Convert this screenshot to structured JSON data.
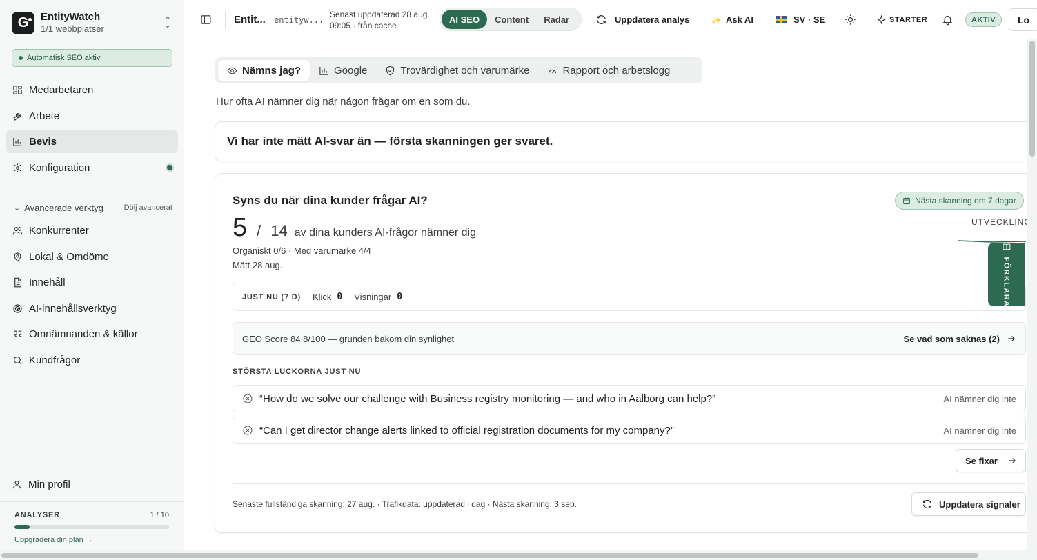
{
  "brand": {
    "name": "EntityWatch",
    "logo_letter": "G",
    "sites": "1/1 webbplatser"
  },
  "sidebar": {
    "seo_badge": "Automatisk SEO aktiv",
    "items": [
      {
        "label": "Medarbetaren",
        "icon": "dashboard-icon"
      },
      {
        "label": "Arbete",
        "icon": "wrench-icon"
      },
      {
        "label": "Bevis",
        "icon": "bar-chart-icon",
        "active": true
      },
      {
        "label": "Konfiguration",
        "icon": "gear-icon"
      }
    ],
    "advanced": {
      "label": "Avancerade verktyg",
      "hide": "Dölj avancerat"
    },
    "advanced_items": [
      {
        "label": "Konkurrenter",
        "icon": "users-icon"
      },
      {
        "label": "Lokal & Omdöme",
        "icon": "map-pin-icon"
      },
      {
        "label": "Innehåll",
        "icon": "document-icon"
      },
      {
        "label": "AI-innehållsverktyg",
        "icon": "target-icon"
      },
      {
        "label": "Omnämnanden & källor",
        "icon": "quote-icon"
      },
      {
        "label": "Kundfrågor",
        "icon": "search-icon"
      }
    ],
    "profile": "Min profil",
    "usage": {
      "label": "ANALYSER",
      "count": "1 / 10",
      "progress": 0.1,
      "upgrade": "Uppgradera din plan →"
    }
  },
  "topbar": {
    "site_name": "Entit...",
    "site_domain": "entityw...",
    "updated": "Senast uppdaterad 28 aug. 09:05 · från cache",
    "segments": [
      "AI SEO",
      "Content",
      "Radar"
    ],
    "refresh": "Uppdatera analys",
    "ask_ai": "Ask AI",
    "locale": "SV · SE",
    "plan": "STARTER",
    "status": "AKTIV",
    "login": "Lo"
  },
  "tabs": [
    "Nämns jag?",
    "Google",
    "Trovärdighet och varumärke",
    "Rapport och arbetslogg"
  ],
  "subtitle": "Hur ofta AI nämner dig när någon frågar om en som du.",
  "notice": "Vi har inte mätt AI-svar än — första skanningen ger svaret.",
  "card": {
    "title": "Syns du när dina kunder frågar AI?",
    "next_scan": "Nästa skanning om 7 dagar",
    "trend_label": "UTVECKLING",
    "mentioned": "5",
    "total": "14",
    "summary": "av dina kunders AI-frågor nämner dig",
    "breakdown": "Organiskt 0/6 · Med varumärke 4/4",
    "measured": "Mätt 28 aug.",
    "now": {
      "label": "JUST NU (7 D)",
      "clicks_label": "Klick",
      "clicks": "0",
      "views_label": "Visningar",
      "views": "0"
    },
    "geo": {
      "text": "GEO Score 84.8/100 — grunden bakom din synlighet",
      "link": "Se vad som saknas (2)"
    },
    "gaps_title": "STÖRSTA LUCKORNA JUST NU",
    "gaps": [
      {
        "query": "“How do we solve our challenge with Business registry monitoring — and who in Aalborg can help?”",
        "status": "AI nämner dig inte"
      },
      {
        "query": "“Can I get director change alerts linked to official registration documents for my company?”",
        "status": "AI nämner dig inte"
      }
    ],
    "fix_button": "Se fixar",
    "footer": "Senaste fullständiga skanning: 27 aug. · Trafikdata: uppdaterad i dag · Nästa skanning: 3 sep.",
    "refresh_signals": "Uppdatera signaler"
  },
  "explain": "FÖRKLARA",
  "colors": {
    "accent": "#2c6a52",
    "accent_light": "#dcece3",
    "border": "#e2e5e5"
  }
}
